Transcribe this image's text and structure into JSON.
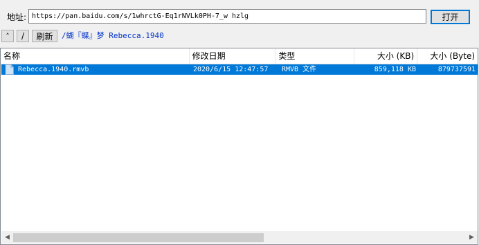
{
  "address_bar": {
    "label": "地址:",
    "url": "https://pan.baidu.com/s/1whrctG-Eq1rNVLk0PH-7_w hzlg",
    "open_button": "打开"
  },
  "nav": {
    "up_label": "˄",
    "root_label": "/",
    "refresh_label": "刷新",
    "current_path": "/蝴『蝶』梦 Rebecca.1940"
  },
  "file_list": {
    "columns": [
      "名称",
      "修改日期",
      "类型",
      "大小 (KB)",
      "大小 (Byte)"
    ],
    "rows": [
      {
        "name": "Rebecca.1940.rmvb",
        "modified": "2020/6/15 12:47:57",
        "type": "RMVB 文件",
        "size_kb": "859,118 KB",
        "size_byte": "879737591",
        "selected": true,
        "icon": "file-icon"
      }
    ]
  },
  "colors": {
    "selection": "#0078d7",
    "path_link": "#0033cc",
    "window_bg": "#f0f0f0"
  }
}
